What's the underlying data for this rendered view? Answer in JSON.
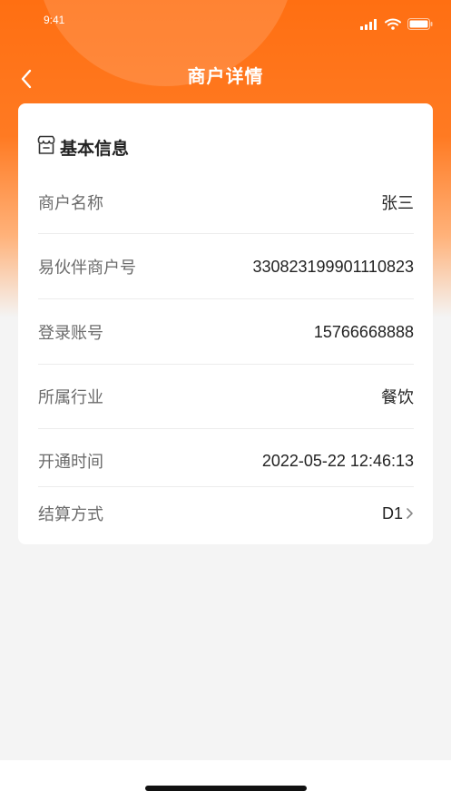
{
  "status_bar": {
    "time": "9:41"
  },
  "nav": {
    "title": "商户详情",
    "back_icon": "chevron-left-icon"
  },
  "card": {
    "header_icon": "store-icon",
    "header_title": "基本信息",
    "rows": [
      {
        "label": "商户名称",
        "value": "张三"
      },
      {
        "label": "易伙伴商户号",
        "value": "330823199901110823"
      },
      {
        "label": "登录账号",
        "value": "15766668888"
      },
      {
        "label": "所属行业",
        "value": "餐饮"
      },
      {
        "label": "开通时间",
        "value": "2022-05-22 12:46:13"
      },
      {
        "label": "结算方式",
        "value": "D1"
      }
    ]
  },
  "colors": {
    "brand_orange": "#ff6f12",
    "background": "#f4f4f4",
    "card": "#ffffff",
    "label_text": "#6b6b6b",
    "value_text": "#222222"
  }
}
